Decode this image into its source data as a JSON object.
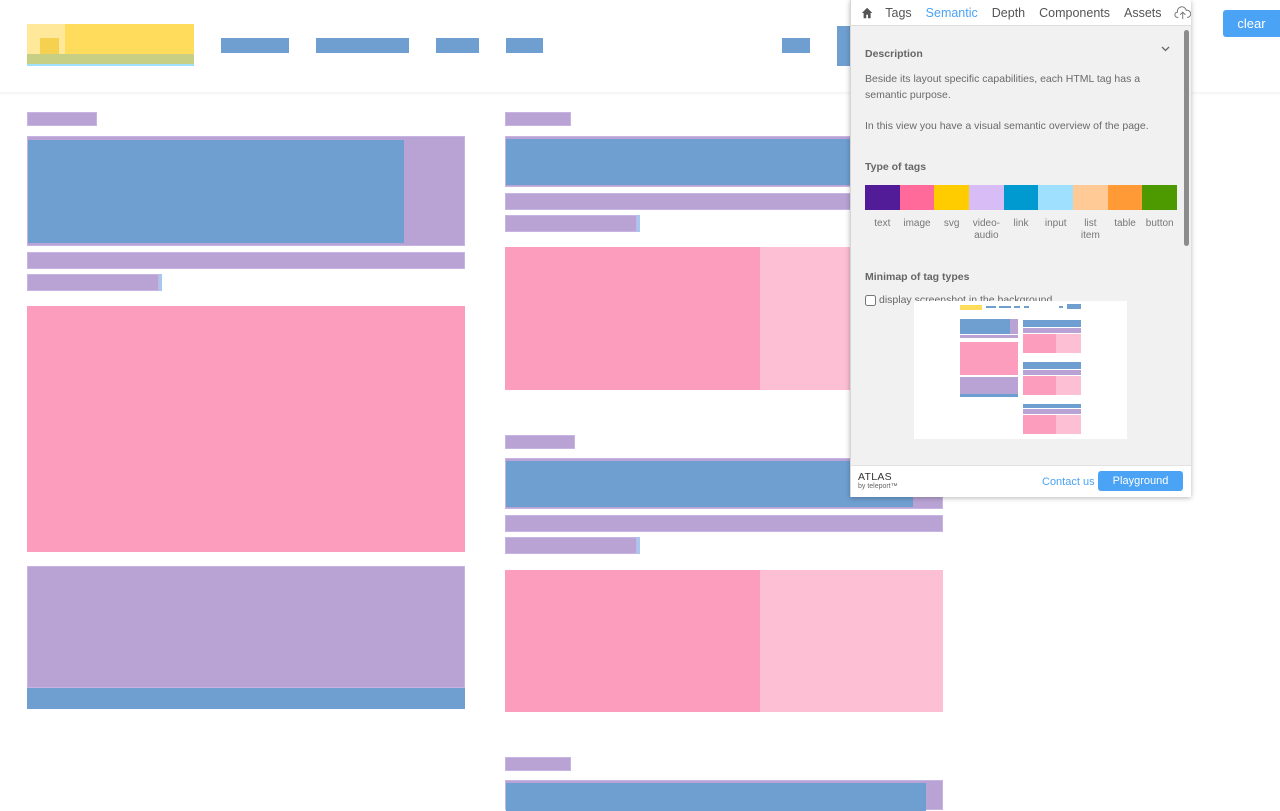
{
  "page": {
    "overlay_mode": "semantic",
    "colors": {
      "text": "#b9a3d4",
      "link": "#6f9fd0",
      "image": "#fc9dbd",
      "image_light": "#fdbfd4",
      "logo_svg": "#ffdc5c"
    }
  },
  "panel": {
    "nav": {
      "home_icon": "home-icon",
      "tabs": [
        {
          "label": "Tags",
          "active": false
        },
        {
          "label": "Semantic",
          "active": true
        },
        {
          "label": "Depth",
          "active": false
        },
        {
          "label": "Components",
          "active": false
        },
        {
          "label": "Assets",
          "active": false
        }
      ],
      "upload_icon": "cloud-upload-icon"
    },
    "description": {
      "title": "Description",
      "paragraph1": "Beside its layout specific capabilities, each HTML tag has a semantic purpose.",
      "paragraph2": "In this view you have a visual semantic overview of the page."
    },
    "types": {
      "title": "Type of tags",
      "items": [
        {
          "label": "text",
          "color": "#521b98"
        },
        {
          "label": "image",
          "color": "#ff6a9b"
        },
        {
          "label": "svg",
          "color": "#ffcc00"
        },
        {
          "label": "video-audio",
          "color": "#d7bcf6"
        },
        {
          "label": "link",
          "color": "#009ad0"
        },
        {
          "label": "input",
          "color": "#9ee0fe"
        },
        {
          "label": "list item",
          "color": "#ffca95"
        },
        {
          "label": "table",
          "color": "#ff9a36"
        },
        {
          "label": "button",
          "color": "#4c9a00"
        }
      ]
    },
    "minimap": {
      "title": "Minimap of tag types",
      "checkbox_label": "display screenshot in the background",
      "checkbox_checked": false
    },
    "footer": {
      "brand": "ATLAS",
      "brand_sub": "by teleport™",
      "contact_label": "Contact us",
      "playground_label": "Playground"
    }
  },
  "toolbar": {
    "clear_label": "clear"
  }
}
